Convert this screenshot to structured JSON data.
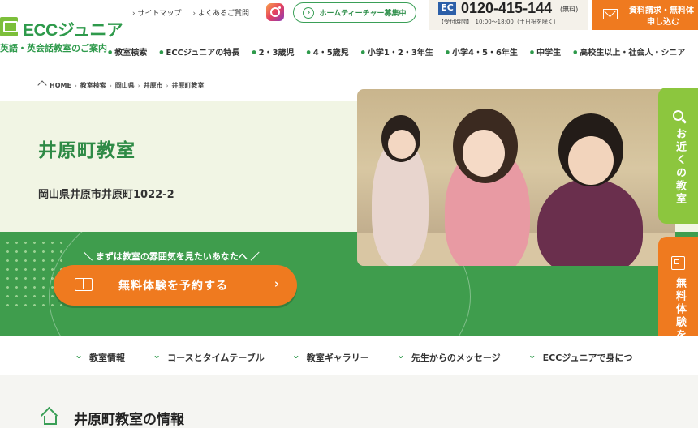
{
  "header": {
    "logo_text": "ECCジュニア",
    "logo_sub": "英語・英会話教室のご案内",
    "top_links": [
      "サイトマップ",
      "よくあるご質問"
    ],
    "teacher_button": "ホームティーチャー募集中",
    "phone": {
      "icon_text": "EC",
      "number": "0120-415-144",
      "free": "(無料)",
      "hours": "【受付時間】　10:00〜18:00（土日祝を除く）"
    },
    "request_button": {
      "line1": "資料請求・無料体",
      "line2": "申し込む"
    },
    "nav": [
      "教室検索",
      "ECCジュニアの特長",
      "2・3歳児",
      "4・5歳児",
      "小学1・2・3年生",
      "小学4・5・6年生",
      "中学生",
      "高校生以上・社会人・シニア"
    ]
  },
  "breadcrumb": [
    "HOME",
    "教室検索",
    "岡山県",
    "井原市",
    "井原町教室"
  ],
  "hero": {
    "title": "井原町教室",
    "address": "岡山県井原市井原町1022-2",
    "catch": "＼ まずは教室の雰囲気を見たいあなたへ ／",
    "cta": "無料体験を予約する"
  },
  "side": {
    "near": "お近くの教室",
    "trial": "無料体験を申し込む"
  },
  "subnav": [
    "教室情報",
    "コースとタイムテーブル",
    "教室ギャラリー",
    "先生からのメッセージ",
    "ECCジュニアで身につ"
  ],
  "section": {
    "title": "井原町教室の情報"
  },
  "colors": {
    "brand_green": "#2e9a4b",
    "band_green": "#3f9d4d",
    "orange": "#ef7a1f",
    "light_green": "#8cc63e"
  }
}
